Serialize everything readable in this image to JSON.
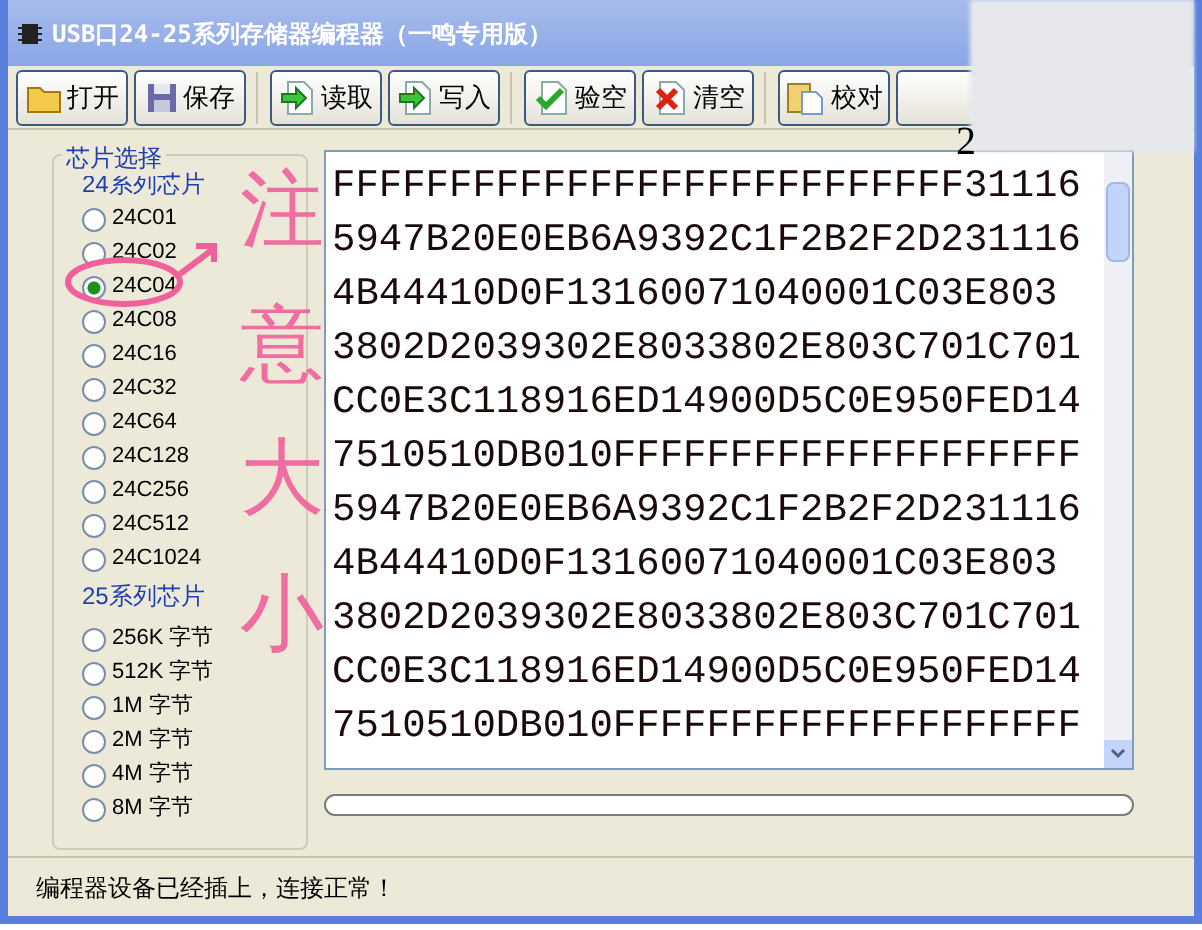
{
  "window": {
    "title": "USB口24-25系列存储器编程器（一鸣专用版）"
  },
  "toolbar": [
    {
      "label": "打开",
      "kind": "open"
    },
    {
      "label": "保存",
      "kind": "save"
    },
    {
      "label": "读取",
      "kind": "read"
    },
    {
      "label": "写入",
      "kind": "write"
    },
    {
      "label": "验空",
      "kind": "check"
    },
    {
      "label": "清空",
      "kind": "clear"
    },
    {
      "label": "校对",
      "kind": "verify"
    }
  ],
  "obscured_text": "2",
  "chip_select": {
    "title": "芯片选择",
    "groups": [
      {
        "label": "24系列芯片",
        "items": [
          {
            "label": "24C01",
            "selected": false
          },
          {
            "label": "24C02",
            "selected": false
          },
          {
            "label": "24C04",
            "selected": true
          },
          {
            "label": "24C08",
            "selected": false
          },
          {
            "label": "24C16",
            "selected": false
          },
          {
            "label": "24C32",
            "selected": false
          },
          {
            "label": "24C64",
            "selected": false
          },
          {
            "label": "24C128",
            "selected": false
          },
          {
            "label": "24C256",
            "selected": false
          },
          {
            "label": "24C512",
            "selected": false
          },
          {
            "label": "24C1024",
            "selected": false
          }
        ]
      },
      {
        "label": "25系列芯片",
        "items": [
          {
            "label": "256K 字节",
            "selected": false
          },
          {
            "label": "512K 字节",
            "selected": false
          },
          {
            "label": "1M 字节",
            "selected": false
          },
          {
            "label": "2M 字节",
            "selected": false
          },
          {
            "label": "4M 字节",
            "selected": false
          },
          {
            "label": "8M 字节",
            "selected": false
          }
        ]
      }
    ]
  },
  "annotation": {
    "text": "注意大小"
  },
  "hex_lines": [
    "FFFFFFFFFFFFFFFFFFFFFFFFFFF31116",
    "5947B20E0EB6A9392C1F2B2F2D231116",
    "4B44410D0F13160071040001C03E803",
    "3802D2039302E8033802E803C701C701",
    "CC0E3C118916ED14900D5C0E950FED14",
    "7510510DB010FFFFFFFFFFFFFFFFFFFF",
    "5947B20E0EB6A9392C1F2B2F2D231116",
    "4B44410D0F13160071040001C03E803",
    "3802D2039302E8033802E803C701C701",
    "CC0E3C118916ED14900D5C0E950FED14",
    "7510510DB010FFFFFFFFFFFFFFFFFFFF"
  ],
  "progress": {
    "level": 0
  },
  "status_bar": "编程器设备已经插上，连接正常！"
}
